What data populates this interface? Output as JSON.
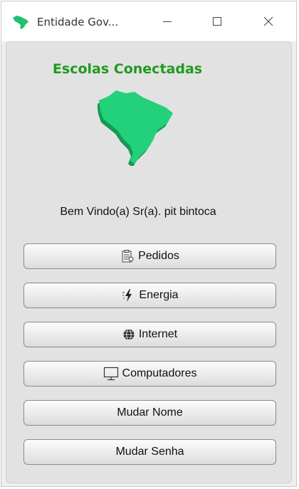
{
  "window": {
    "title": "Entidade Gov...",
    "controls": {
      "minimize_icon": "minimize-icon",
      "maximize_icon": "maximize-icon",
      "close_icon": "close-icon"
    }
  },
  "header": {
    "title": "Escolas Conectadas",
    "logo_icon": "brazil-map-icon"
  },
  "welcome_text": "Bem Vindo(a) Sr(a).  pit bintoca",
  "buttons": [
    {
      "label": "Pedidos",
      "icon": "clipboard-icon"
    },
    {
      "label": "Energia",
      "icon": "energy-icon"
    },
    {
      "label": "Internet",
      "icon": "globe-icon"
    },
    {
      "label": "Computadores",
      "icon": "monitor-icon"
    },
    {
      "label": "Mudar Nome",
      "icon": ""
    },
    {
      "label": "Mudar Senha",
      "icon": ""
    }
  ],
  "colors": {
    "brand_green": "#1f9a1f",
    "map_green": "#22d17a",
    "map_shadow": "#159a55"
  }
}
